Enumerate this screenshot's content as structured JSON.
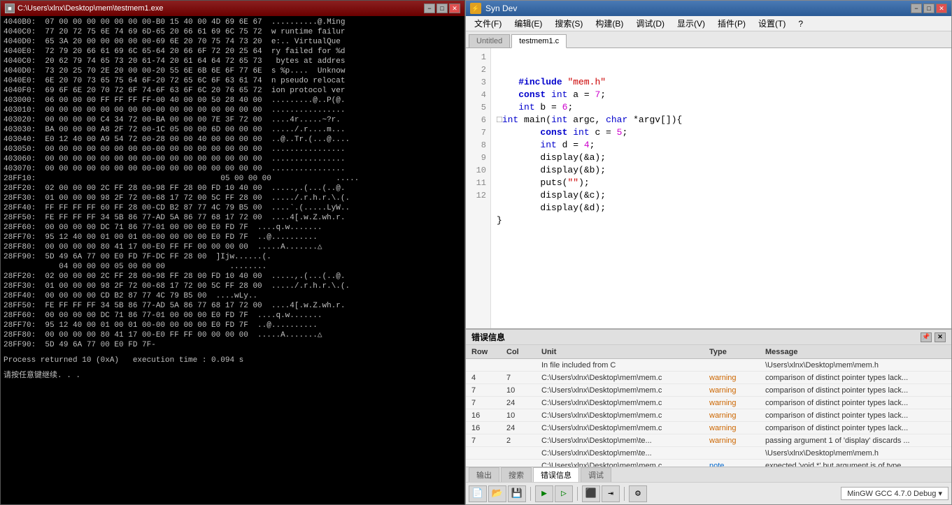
{
  "terminal": {
    "title": "C:\\Users\\xlnx\\Desktop\\mem\\testmem1.exe",
    "lines": [
      "4040B0:  07 00 00 00 00 00 00 00-B0 15 40 00 4D 69 6E 67  ..........@.Ming",
      "4040C0:  77 20 72 75 6E 74 69 6D-65 20 66 61 69 6C 75 72  w runtime failur",
      "4040D0:  65 3A 20 00 00 00 00 00-69 6E 20 70 75 74 73 20  e:.. VirtualQue",
      "4040E0:  72 79 20 66 61 69 6C 65-64 20 66 6F 72 20 25 64  ry failed for %d",
      "4040C0:  20 62 79 74 65 73 20 61-74 20 61 64 64 72 65 73   bytes at addres",
      "4040D0:  73 20 25 70 2E 20 00 00-20 55 6E 6B 6E 6F 77 6E  s %p....  Unknow",
      "4040E0:  6E 20 70 73 65 75 64 6F-20 72 65 6C 6F 63 61 74  n pseudo relocat",
      "4040F0:  69 6F 6E 20 70 72 6F 74-6F 63 6F 6C 20 76 65 72  ion protocol ver",
      "",
      "403000:  06 00 00 00 FF FF FF FF-00 40 00 00 50 28 40 00  .........@..P(@.",
      "403010:  00 00 00 00 00 00 00 00-00 00 00 00 00 00 00 00  ................",
      "403020:  00 00 00 00 C4 34 72 00-BA 00 00 00 7E 3F 72 00  ....4r.....~?r.",
      "403030:  BA 00 00 00 A8 2F 72 00-1C 05 00 00 6D 00 00 00  ...../.r....m...",
      "403040:  E0 12 40 00 A9 54 72 00-28 00 00 40 00 00 00 00  ..@..Tr.(...@....",
      "403050:  00 00 00 00 00 00 00 00-00 00 00 00 00 00 00 00  ................",
      "403060:  00 00 00 00 00 00 00 00-00 00 00 00 00 00 00 00  ................",
      "403070:  00 00 00 00 00 00 00 00-00 00 00 00 00 00 00 00  ................",
      "",
      "28FF10:                                        05 00 00 00              .....",
      "28FF20:  02 00 00 00 2C FF 28 00-98 FF 28 00 FD 10 40 00  .....,.(...(..@.",
      "28FF30:  01 00 00 00 98 2F 72 00-68 17 72 00 5C FF 28 00  ...../.r.h.r.\\.(.",
      "28FF40:  FF FF FF FF 60 FF 28 00-CD B2 87 77 4C 79 B5 00  ....`.(.....LyW..",
      "28FF50:  FE FF FF FF 34 5B 86 77-AD 5A 86 77 68 17 72 00  ....4[.w.Z.wh.r.",
      "28FF60:  00 00 00 00 DC 71 86 77-01 00 00 00 E0 FD 7F  ....q.w.......",
      "28FF70:  95 12 40 00 01 00 01 00-00 00 00 00 E0 FD 7F  ..@..........",
      "28FF80:  00 00 00 00 80 41 17 00-E0 FF FF 00 00 00 00  .....A.......△",
      "28FF90:  5D 49 6A 77 00 E0 FD 7F-DC FF 28 00  ]Ijw......(.",
      "",
      "            04 00 00 00 05 00 00 00              ........",
      "28FF20:  02 00 00 00 2C FF 28 00-98 FF 28 00 FD 10 40 00  .....,.(...(..@.",
      "28FF30:  01 00 00 00 98 2F 72 00-68 17 72 00 5C FF 28 00  ...../.r.h.r.\\.(.",
      "28FF40:  00 00 00 00 CD B2 87 77 4C 79 B5 00  ....wLy..",
      "28FF50:  FE FF FF FF 34 5B 86 77-AD 5A 86 77 68 17 72 00  ....4[.w.Z.wh.r.",
      "28FF60:  00 00 00 00 DC 71 86 77-01 00 00 00 E0 FD 7F  ....q.w.......",
      "28FF70:  95 12 40 00 01 00 01 00-00 00 00 00 E0 FD 7F  ..@..........",
      "28FF80:  00 00 00 00 80 41 17 00-E0 FF FF 00 00 00 00  .....A.......△",
      "28FF90:  5D 49 6A 77 00 E0 FD 7F-"
    ],
    "footer1": "Process returned 10 (0xA)   execution time : 0.094 s",
    "footer2": "请按任意键继续. . ."
  },
  "ide": {
    "title": "Syn Dev",
    "logo": "⚡",
    "menus": [
      "文件(F)",
      "编辑(E)",
      "搜索(S)",
      "构建(B)",
      "调试(D)",
      "显示(V)",
      "插件(P)",
      "设置(T)",
      "?"
    ],
    "tabs": [
      {
        "label": "Untitled",
        "active": false
      },
      {
        "label": "testmem1.c",
        "active": true
      }
    ],
    "code_lines": [
      {
        "num": 1,
        "text": "    #include \"mem.h\"",
        "type": "include"
      },
      {
        "num": 2,
        "text": "    const int a = 7;",
        "type": "code"
      },
      {
        "num": 3,
        "text": "    int b = 6;",
        "type": "code"
      },
      {
        "num": 4,
        "text": "□int main(int argc, char *argv[]){",
        "type": "function"
      },
      {
        "num": 5,
        "text": "        const int c = 5;",
        "type": "code"
      },
      {
        "num": 6,
        "text": "        int d = 4;",
        "type": "code"
      },
      {
        "num": 7,
        "text": "        display(&a);",
        "type": "code"
      },
      {
        "num": 8,
        "text": "        display(&b);",
        "type": "code"
      },
      {
        "num": 9,
        "text": "        puts(\"\");",
        "type": "code"
      },
      {
        "num": 10,
        "text": "        display(&c);",
        "type": "code"
      },
      {
        "num": 11,
        "text": "        display(&d);",
        "type": "code"
      },
      {
        "num": 12,
        "text": "}",
        "type": "brace"
      }
    ],
    "error_panel": {
      "title": "错误信息",
      "headers": [
        "Row",
        "Col",
        "Unit",
        "Type",
        "Message"
      ],
      "rows": [
        {
          "row": "",
          "col": "",
          "unit": "In file included from C",
          "type": "",
          "message": "\\Users\\xlnx\\Desktop\\mem\\mem.h"
        },
        {
          "row": "4",
          "col": "7",
          "unit": "C:\\Users\\xlnx\\Desktop\\mem\\mem.c",
          "type": "warning",
          "message": "comparison of distinct pointer types lack..."
        },
        {
          "row": "7",
          "col": "10",
          "unit": "C:\\Users\\xlnx\\Desktop\\mem\\mem.c",
          "type": "warning",
          "message": "comparison of distinct pointer types lack..."
        },
        {
          "row": "7",
          "col": "24",
          "unit": "C:\\Users\\xlnx\\Desktop\\mem\\mem.c",
          "type": "warning",
          "message": "comparison of distinct pointer types lack..."
        },
        {
          "row": "16",
          "col": "10",
          "unit": "C:\\Users\\xlnx\\Desktop\\mem\\mem.c",
          "type": "warning",
          "message": "comparison of distinct pointer types lack..."
        },
        {
          "row": "16",
          "col": "24",
          "unit": "C:\\Users\\xlnx\\Desktop\\mem\\mem.c",
          "type": "warning",
          "message": "comparison of distinct pointer types lack..."
        },
        {
          "row": "7",
          "col": "2",
          "unit": "C:\\Users\\xlnx\\Desktop\\mem\\te...",
          "type": "warning",
          "message": "passing argument 1 of 'display' discards ..."
        },
        {
          "row": "",
          "col": "",
          "unit": "C:\\Users\\xlnx\\Desktop\\mem\\te...",
          "type": "",
          "message": "\\Users\\xlnx\\Desktop\\mem\\mem.h"
        },
        {
          "row": "",
          "col": "",
          "unit": "C:\\Users\\xlnx\\Desktop\\mem\\mem.c",
          "type": "note",
          "message": "expected 'void *' but argument is of type..."
        }
      ],
      "subtabs": [
        "输出",
        "搜索",
        "错误信息",
        "调试"
      ]
    },
    "toolbar": {
      "compiler": "MinGW GCC 4.7.0 Debug ▾"
    }
  }
}
